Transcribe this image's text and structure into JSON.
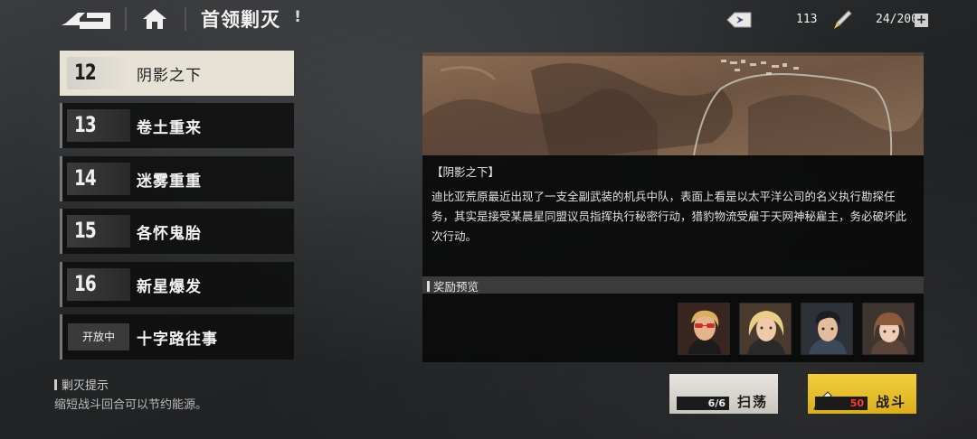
{
  "header": {
    "title": "首领剿灭",
    "info_mark": "!",
    "ticket_count": "113",
    "energy": "24/200",
    "plus": "+"
  },
  "stages": [
    {
      "num": "12",
      "name": "阴影之下",
      "active": true
    },
    {
      "num": "13",
      "name": "卷土重来"
    },
    {
      "num": "14",
      "name": "迷雾重重"
    },
    {
      "num": "15",
      "name": "各怀鬼胎"
    },
    {
      "num": "16",
      "name": "新星爆发"
    },
    {
      "tag": "开放中",
      "name": "十字路往事"
    }
  ],
  "hint": {
    "title": "剿灭提示",
    "text": "缩短战斗回合可以节约能源。"
  },
  "detail": {
    "title": "【阴影之下】",
    "text": "迪比亚荒原最近出现了一支全副武装的机兵中队，表面上看是以太平洋公司的名义执行勘探任务，其实是接受某晨星同盟议员指挥执行秘密行动，猎豹物流受雇于天网神秘雇主，务必破坏此次行动。"
  },
  "rewards": {
    "label": "奖励预览",
    "avatars": [
      "avatar-sunglasses",
      "avatar-blonde",
      "avatar-dark-hair",
      "avatar-bangs"
    ]
  },
  "actions": {
    "sweep_cost": "6/6",
    "sweep_label": "扫荡",
    "battle_cost": "50",
    "battle_label": "战斗"
  },
  "colors": {
    "active_stage": "#e7e2d6",
    "battle_button": "#f2cf3d",
    "battle_cost": "#ff3b2f"
  }
}
